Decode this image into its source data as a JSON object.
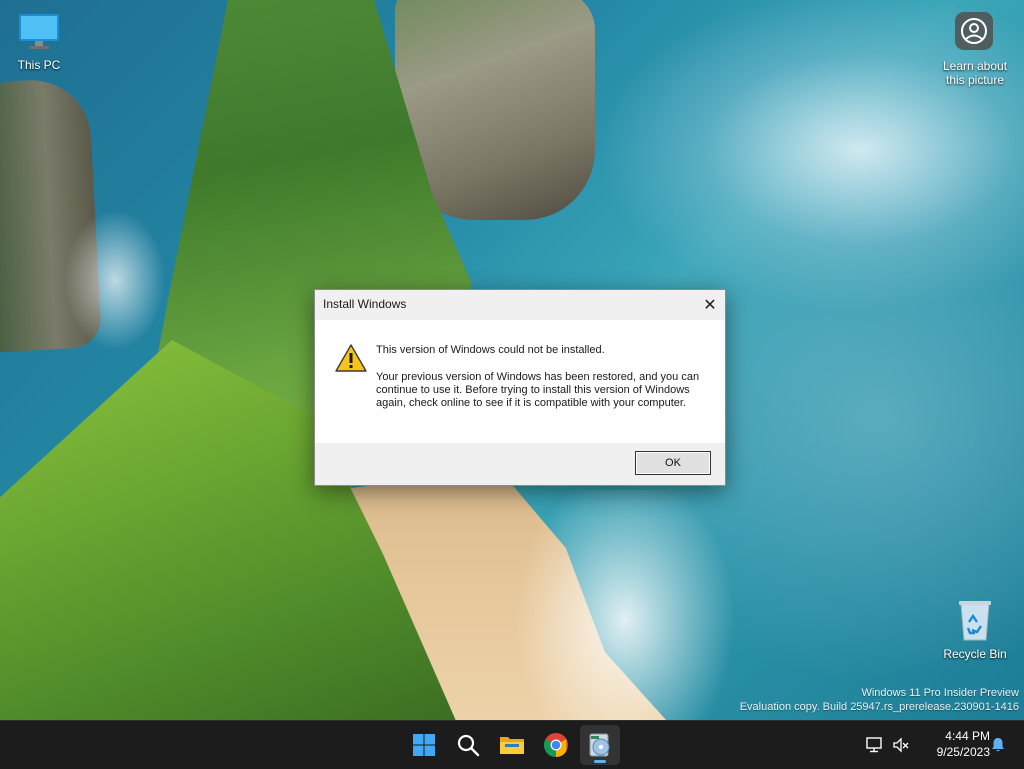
{
  "desktop": {
    "icons": [
      {
        "label": "This PC",
        "icon": "monitor-icon"
      },
      {
        "label": "Learn about this picture",
        "icon": "camera-icon"
      },
      {
        "label": "Recycle Bin",
        "icon": "recycle-bin-icon"
      }
    ],
    "learn_line1": "Learn about",
    "learn_line2": "this picture"
  },
  "dialog": {
    "title": "Install Windows",
    "close_icon": "close-icon",
    "warning_icon": "warning-icon",
    "heading": "This version of Windows could not be installed.",
    "body": "Your previous version of Windows has been restored, and you can continue to use it.  Before trying to install this version of Windows again, check online to see if it is compatible with your computer.",
    "ok_label": "OK"
  },
  "watermark": {
    "line1": "Windows 11 Pro Insider Preview",
    "line2": "Evaluation copy. Build 25947.rs_prerelease.230901-1416"
  },
  "taskbar": {
    "items": [
      {
        "name": "start",
        "icon": "windows-logo-icon"
      },
      {
        "name": "search",
        "icon": "search-icon"
      },
      {
        "name": "file-explorer",
        "icon": "folder-icon"
      },
      {
        "name": "chrome",
        "icon": "chrome-icon"
      },
      {
        "name": "setup",
        "icon": "setup-disc-icon",
        "active": true
      }
    ],
    "tray": {
      "network_icon": "network-icon",
      "volume_icon": "volume-muted-icon",
      "notification_icon": "bell-icon"
    },
    "time": "4:44 PM",
    "date": "9/25/2023"
  },
  "colors": {
    "taskbar_bg": "#1c1c1c",
    "accent": "#5fb2f2",
    "dialog_footer": "#f0f0f0"
  }
}
